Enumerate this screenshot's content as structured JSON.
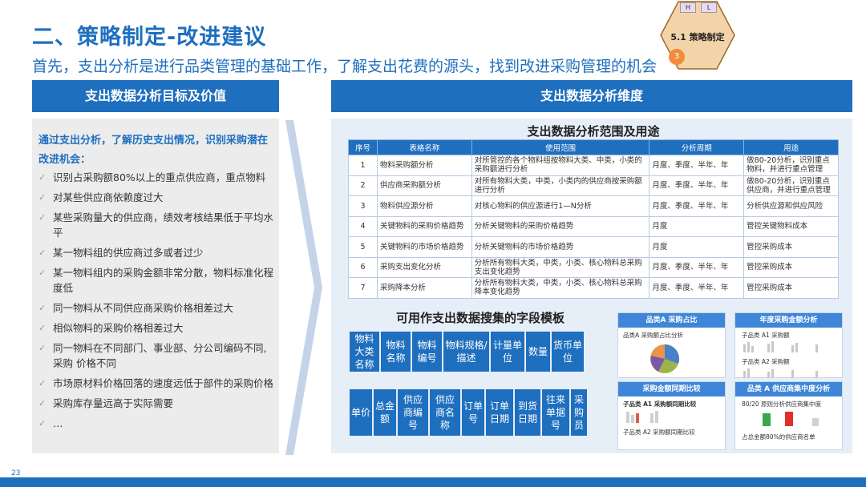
{
  "title": "二、策略制定-改进建议",
  "subtitle": "首先，支出分析是进行品类管理的基础工作，了解支出花费的源头，找到改进采购管理的机会",
  "badge": {
    "tab_h": "H",
    "tab_l": "L",
    "label": "5.1 策略制定",
    "number": "3",
    "color": "#f28c3c"
  },
  "left": {
    "header": "支出数据分析目标及价值",
    "intro": "通过支出分析，了解历史支出情况，识别采购潜在改进机会：",
    "items": [
      "识别占采购额80%以上的重点供应商，重点物料",
      "对某些供应商依赖度过大",
      "某些采购量大的供应商，绩效考核结果低于平均水平",
      "某一物料组的供应商过多或者过少",
      "某一物料组内的采购金额非常分散，物料标准化程度低",
      "同一物料从不同供应商采购价格相差过大",
      "相似物料的采购价格相差过大",
      "同一物料在不同部门、事业部、分公司编码不同,采购 价格不同",
      "市场原材料价格回落的速度远低于部件的采购价格",
      "采购库存量远高于实际需要",
      "…"
    ]
  },
  "right": {
    "header": "支出数据分析维度",
    "range_title": "支出数据分析范围及用途",
    "table": {
      "headers": [
        "序号",
        "表格名称",
        "使用范围",
        "分析周期",
        "用途"
      ],
      "rows": [
        [
          "1",
          "物料采购额分析",
          "对所管控的各个物料组按物料大类、中类，小类的采购额进行分析",
          "月度、季度、半年、年",
          "做80-20分析，识别重点物料，并进行重点管理"
        ],
        [
          "2",
          "供应商采购额分析",
          "对所有物料大类，中类，小类内的供应商按采购额进行分析",
          "月度、季度、半年、年",
          "做80-20分析，识别重点供应商，并进行重点管理"
        ],
        [
          "3",
          "物料供应源分析",
          "对核心物料的供应源进行1—N分析",
          "月度、季度、半年、年",
          "分析供应源和供应风险"
        ],
        [
          "4",
          "关键物料的采购价格趋势",
          "分析关键物料的采购价格趋势",
          "月度",
          "管控关键物料成本"
        ],
        [
          "5",
          "关键物料的市场价格趋势",
          "分析关键物料的市场价格趋势",
          "月度",
          "管控采购成本"
        ],
        [
          "6",
          "采购支出变化分析",
          "分析所有物料大类，中类，小类、核心物料总采购支出变化趋势",
          "月度、季度、半年、年",
          "管控采购成本"
        ],
        [
          "7",
          "采购降本分析",
          "分析所有物料大类，中类，小类、核心物料总采购降本变化趋势",
          "月度、季度、半年、年",
          "管控采购成本"
        ]
      ]
    },
    "field_title": "可用作支出数据搜集的字段模板",
    "fields_row1": [
      "物料大类名称",
      "物料名称",
      "物料编号",
      "物料规格/描述",
      "计量单位",
      "数量",
      "货币单位"
    ],
    "fields_row2": [
      "单价",
      "总金额",
      "供应商编号",
      "供应商名称",
      "订单号",
      "订单日期",
      "到货日期",
      "往来单据号",
      "采购员"
    ],
    "thumbs": [
      {
        "title": "品类A 采购占比",
        "line1": "品类A 采购额占比分析",
        "line2": ""
      },
      {
        "title": "年度采购金额分析",
        "line1": "子品类 A1 采购额",
        "line2": "子品类 A2 采购额"
      },
      {
        "title": "采购金额同期比较",
        "line1": "子品类 A1 采购额同期比较",
        "line2": "子品类 A2 采购额同期比较"
      },
      {
        "title": "品类 A 供应商集中度分析",
        "line1": "80/20 原则分析供应商集中度",
        "line2": "占总金额80%的供应商名单"
      }
    ]
  },
  "page_number": "23",
  "colors": {
    "primary": "#1f6fbf",
    "panel_left": "#ececec",
    "panel_right": "#e6eef8"
  }
}
